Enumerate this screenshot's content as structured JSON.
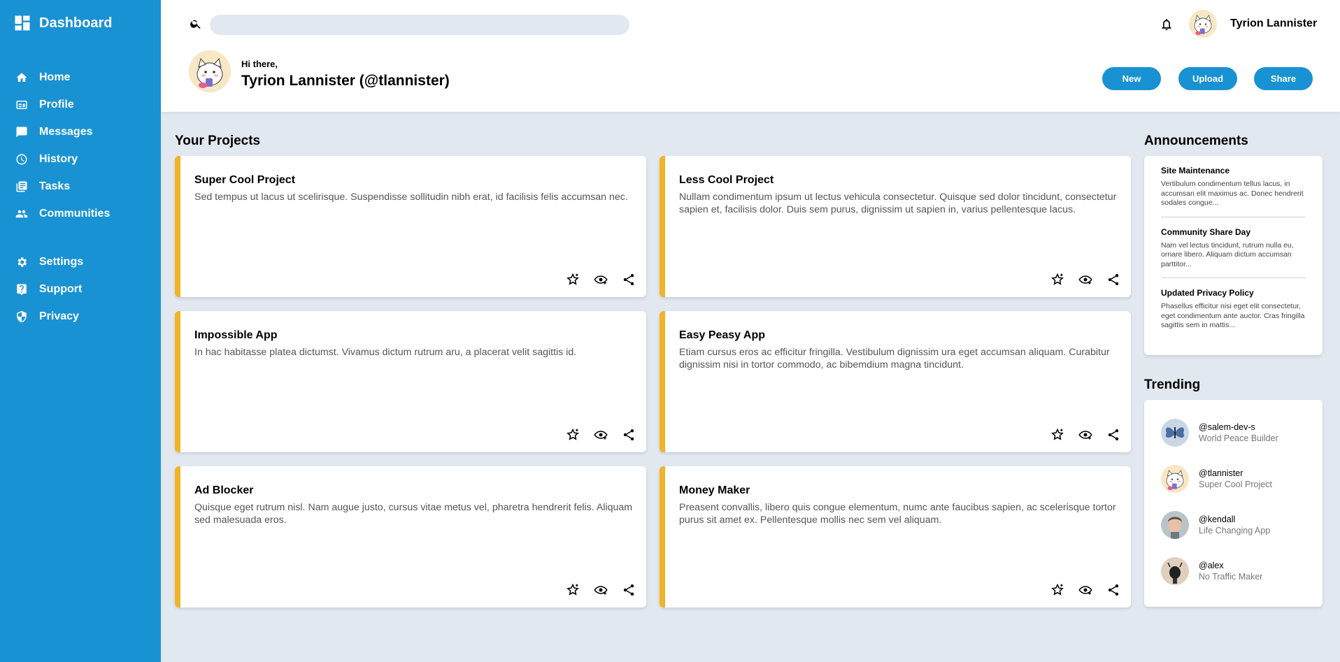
{
  "sidebar": {
    "brand": "Dashboard",
    "main_items": [
      {
        "label": "Home",
        "icon": "home-icon"
      },
      {
        "label": "Profile",
        "icon": "profile-card-icon"
      },
      {
        "label": "Messages",
        "icon": "message-icon"
      },
      {
        "label": "History",
        "icon": "clock-icon"
      },
      {
        "label": "Tasks",
        "icon": "tasks-icon"
      },
      {
        "label": "Communities",
        "icon": "group-icon"
      }
    ],
    "secondary_items": [
      {
        "label": "Settings",
        "icon": "gear-icon"
      },
      {
        "label": "Support",
        "icon": "help-icon"
      },
      {
        "label": "Privacy",
        "icon": "shield-icon"
      }
    ]
  },
  "header": {
    "search_placeholder": "",
    "username": "Tyrion Lannister",
    "greeting": "Hi there,",
    "fullname": "Tyrion Lannister (@tlannister)",
    "buttons": {
      "new": "New",
      "upload": "Upload",
      "share": "Share"
    }
  },
  "projects": {
    "title": "Your Projects",
    "items": [
      {
        "title": "Super Cool Project",
        "desc": "Sed tempus ut lacus ut scelirisque. Suspendisse sollitudin nibh erat, id facilisis felis accumsan nec."
      },
      {
        "title": "Less Cool Project",
        "desc": "Nullam condimentum ipsum ut lectus vehicula consectetur. Quisque sed dolor tincidunt, consectetur sapien et, facilisis dolor. Duis sem purus, dignissim ut sapien in, varius pellentesque lacus."
      },
      {
        "title": "Impossible App",
        "desc": "In hac habitasse platea dictumst. Vivamus dictum rutrum aru, a placerat velit sagittis id."
      },
      {
        "title": "Easy Peasy App",
        "desc": "Etiam cursus eros ac efficitur fringilla. Vestibulum dignissim ura eget accumsan aliquam. Curabitur dignissim nisi in tortor commodo, ac bibemdium magna tincidunt."
      },
      {
        "title": "Ad Blocker",
        "desc": "Quisque eget rutrum nisl. Nam augue justo, cursus vitae metus vel, pharetra hendrerit felis. Aliquam sed malesuada eros."
      },
      {
        "title": "Money Maker",
        "desc": "Preasent convallis, libero quis congue elementum, numc ante faucibus sapien, ac scelerisque tortor purus sit amet ex. Pellentesque mollis nec sem vel aliquam."
      }
    ]
  },
  "announcements": {
    "title": "Announcements",
    "items": [
      {
        "title": "Site Maintenance",
        "body": "Vertibulum condimentum tellus lacus, in accumsan elit maximus ac. Donec hendrerit sodales congue..."
      },
      {
        "title": "Community Share Day",
        "body": "Nam vel lectus tincidunt, rutrum nulla eu, ornare libero. Aliquam dictum accumsan parttitor..."
      },
      {
        "title": "Updated Privacy Policy",
        "body": "Phasellus efficitur nisi eget elit consectetur, eget condimentum ante auctor. Cras fringilla sagittis sem in mattis..."
      }
    ]
  },
  "trending": {
    "title": "Trending",
    "items": [
      {
        "handle": "@salem-dev-s",
        "project": "World Peace Builder",
        "avatar": "butterfly-avatar"
      },
      {
        "handle": "@tlannister",
        "project": "Super Cool Project",
        "avatar": "cat-avatar"
      },
      {
        "handle": "@kendall",
        "project": "Life Changing App",
        "avatar": "portrait-avatar"
      },
      {
        "handle": "@alex",
        "project": "No Traffic Maker",
        "avatar": "sketch-avatar"
      }
    ]
  },
  "colors": {
    "primary": "#1992d4",
    "accent": "#f0b429",
    "background": "#e2e8f0"
  }
}
